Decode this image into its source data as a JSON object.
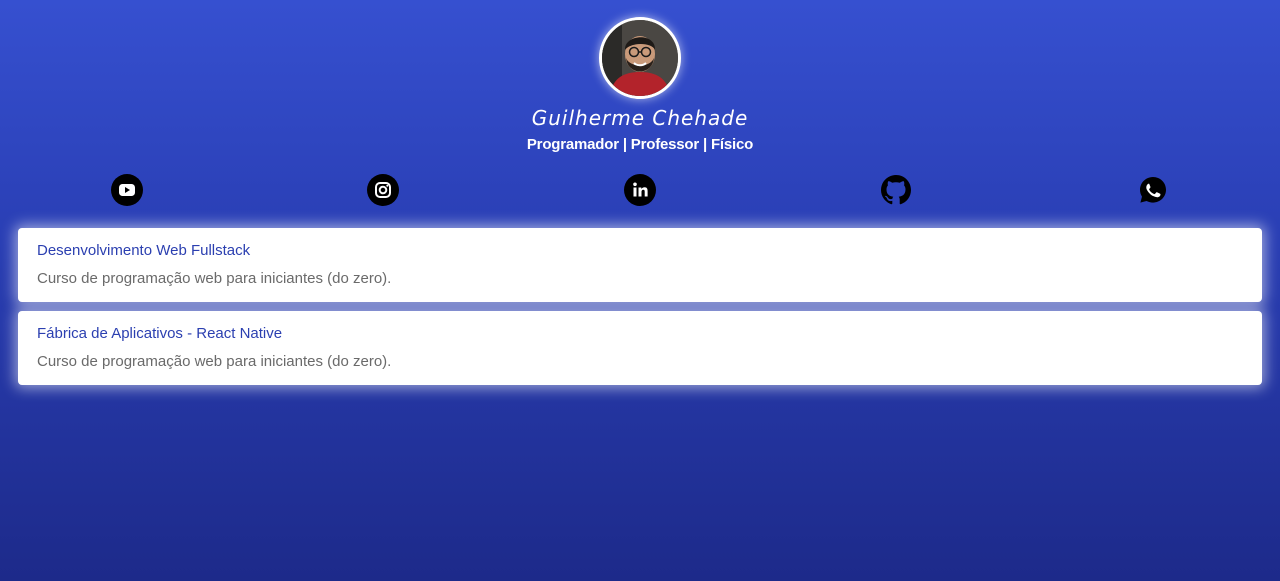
{
  "profile": {
    "name": "Guilherme Chehade",
    "subtitle": "Programador | Professor | Físico",
    "avatar_icon": "profile-photo"
  },
  "socials": [
    {
      "icon": "youtube-icon",
      "name": "YouTube"
    },
    {
      "icon": "instagram-icon",
      "name": "Instagram"
    },
    {
      "icon": "linkedin-icon",
      "name": "LinkedIn"
    },
    {
      "icon": "github-icon",
      "name": "GitHub"
    },
    {
      "icon": "whatsapp-icon",
      "name": "WhatsApp"
    }
  ],
  "cards": [
    {
      "title": "Desenvolvimento Web Fullstack",
      "description": "Curso de programação web para iniciantes (do zero)."
    },
    {
      "title": "Fábrica de Aplicativos - React Native",
      "description": "Curso de programação web para iniciantes (do zero)."
    }
  ],
  "colors": {
    "background_top": "#3650d0",
    "background_bottom": "#1d2a8a",
    "card_title": "#2b3fb0",
    "card_desc": "#6a6a6a",
    "icon": "#000000"
  }
}
